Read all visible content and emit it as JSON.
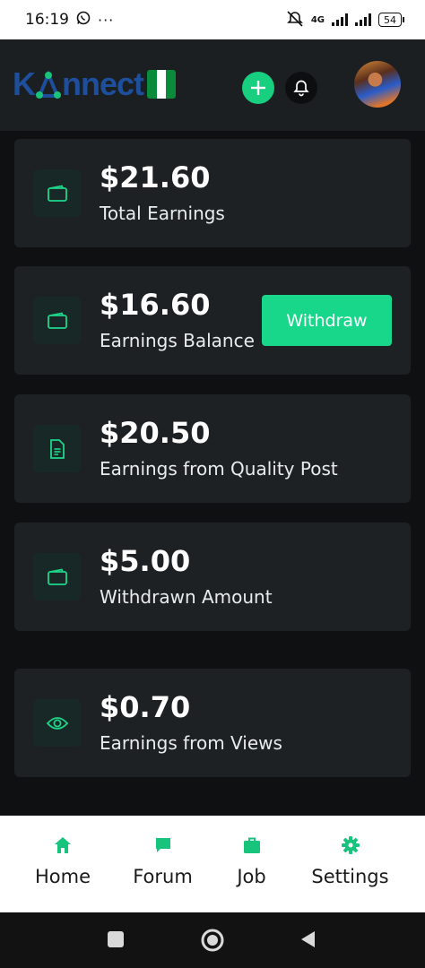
{
  "status_bar": {
    "time": "16:19",
    "more": "···",
    "network": "4G",
    "battery": "54"
  },
  "header": {
    "logo_text_pre": "K",
    "logo_text_post": "nnect",
    "accent_color": "#18cf7f",
    "plus_icon": "plus-icon",
    "bell_icon": "bell-icon"
  },
  "cards": [
    {
      "amount": "$21.60",
      "label": "Total Earnings",
      "icon": "wallet-icon"
    },
    {
      "amount": "$16.60",
      "label": "Earnings Balance",
      "icon": "wallet-icon",
      "action": "Withdraw"
    },
    {
      "amount": "$20.50",
      "label": "Earnings from Quality Post",
      "icon": "document-icon"
    },
    {
      "amount": "$5.00",
      "label": "Withdrawn Amount",
      "icon": "wallet-icon"
    },
    {
      "amount": "$0.70",
      "label": "Earnings from Views",
      "icon": "eye-icon"
    }
  ],
  "bottom_nav": [
    {
      "label": "Home",
      "icon": "home-icon"
    },
    {
      "label": "Forum",
      "icon": "chat-icon"
    },
    {
      "label": "Job",
      "icon": "briefcase-icon"
    },
    {
      "label": "Settings",
      "icon": "gear-icon"
    }
  ]
}
